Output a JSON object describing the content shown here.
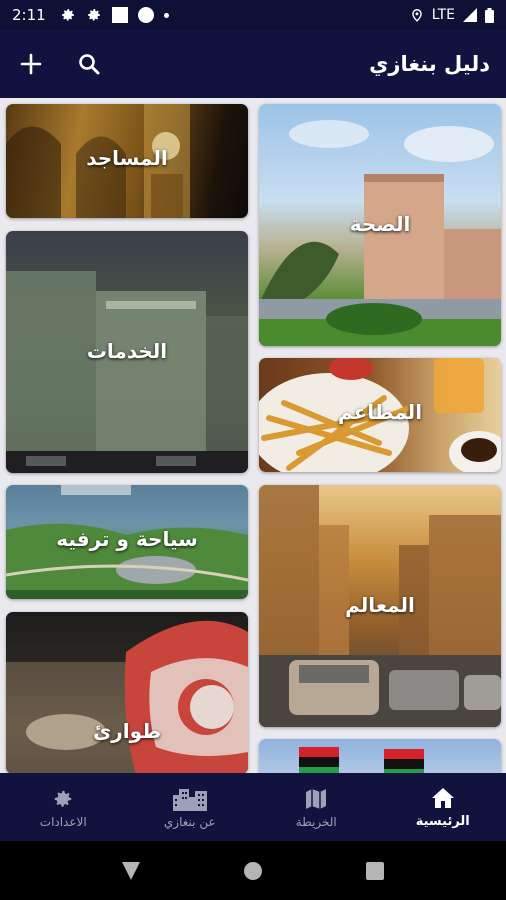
{
  "status_bar": {
    "time": "2:11",
    "network": "LTE"
  },
  "app_bar": {
    "title": "دليل بنغازي",
    "add_icon": "plus-icon",
    "search_icon": "search-icon"
  },
  "categories": {
    "mosques": "المساجد",
    "health": "الصحة",
    "services": "الخدمات",
    "restaurants": "المطاعم",
    "tourism": "سياحة و ترفيه",
    "landmarks": "المعالم",
    "emergency": "طوارئ"
  },
  "bottom_nav": {
    "home": "الرئيسية",
    "map": "الخريطة",
    "about": "عن بنغازي",
    "settings": "الاعدادات"
  },
  "colors": {
    "primary": "#12123e",
    "status_bar": "#0f1035",
    "background": "#e9e9ee",
    "nav_inactive": "#9ea0b8"
  }
}
